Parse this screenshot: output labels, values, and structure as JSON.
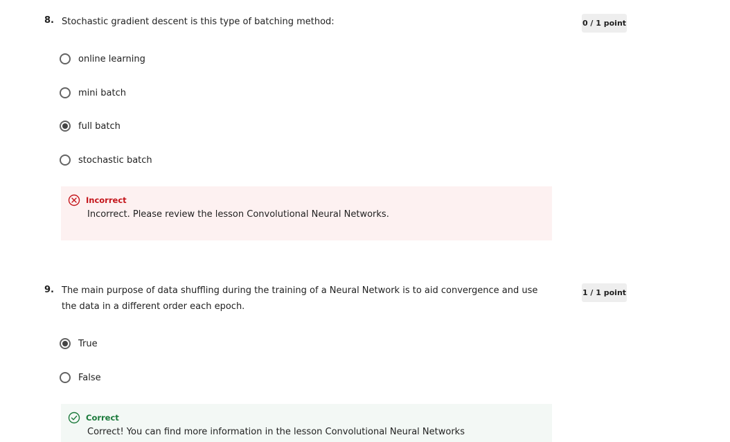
{
  "questions": [
    {
      "number": "8.",
      "text": "Stochastic gradient descent is this type of batching method:",
      "points": "0 / 1 point",
      "options": [
        {
          "label": "online learning",
          "selected": false
        },
        {
          "label": "mini batch",
          "selected": false
        },
        {
          "label": "full batch",
          "selected": true
        },
        {
          "label": "stochastic batch",
          "selected": false
        }
      ],
      "feedback": {
        "status": "incorrect",
        "title": "Incorrect",
        "message": "Incorrect. Please review the lesson Convolutional Neural Networks.",
        "icon": "x-circle-icon",
        "color": "#c4151b"
      }
    },
    {
      "number": "9.",
      "text": "The main purpose of data shuffling during the training of a Neural Network is to aid convergence and use the data in a different order each epoch.",
      "points": "1 / 1 point",
      "options": [
        {
          "label": "True",
          "selected": true
        },
        {
          "label": "False",
          "selected": false
        }
      ],
      "feedback": {
        "status": "correct",
        "title": "Correct",
        "message": "Correct! You can find more information in the lesson Convolutional Neural Networks",
        "icon": "check-circle-icon",
        "color": "#1b7a3b"
      }
    }
  ]
}
